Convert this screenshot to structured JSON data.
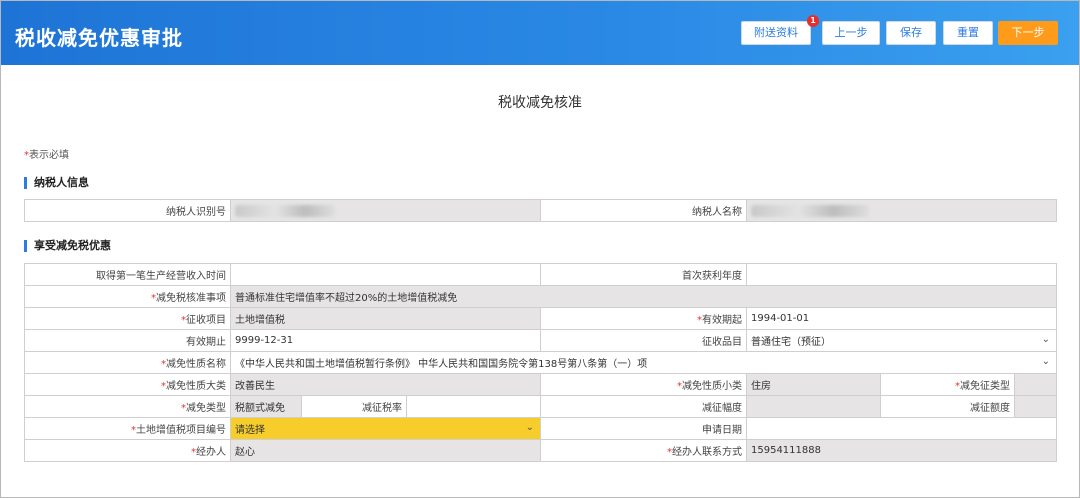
{
  "header": {
    "title": "税收减免优惠审批",
    "buttons": {
      "attach": "附送资料",
      "prev": "上一步",
      "save": "保存",
      "reset": "重置",
      "next": "下一步"
    },
    "attach_badge": "1"
  },
  "page_title": "税收减免核准",
  "required_note": "表示必填",
  "required_star": "*",
  "taxpayer": {
    "section": "纳税人信息",
    "id_label": "纳税人识别号",
    "name_label": "纳税人名称"
  },
  "benefit": {
    "section": "享受减免税优惠",
    "first_income_time_label": "取得第一笔生产经营收入时间",
    "first_income_time_value": "",
    "first_profit_year_label": "首次获利年度",
    "first_profit_year_value": "",
    "approval_item_label": "减免税核准事项",
    "approval_item_value": "普通标准住宅增值率不超过20%的土地增值税减免",
    "levy_item_label": "征收项目",
    "levy_item_value": "土地增值税",
    "valid_from_label": "有效期起",
    "valid_from_value": "1994-01-01",
    "valid_to_label": "有效期止",
    "valid_to_value": "9999-12-31",
    "levy_category_label": "征收品目",
    "levy_category_value": "普通住宅（预征）",
    "nature_name_label": "减免性质名称",
    "nature_name_value": "《中华人民共和国土地增值税暂行条例》 中华人民共和国国务院令第138号第八条第（一）项",
    "nature_major_label": "减免性质大类",
    "nature_major_value": "改善民生",
    "nature_minor_label": "减免性质小类",
    "nature_minor_value": "住房",
    "levy_reduction_type_label": "减免征类型",
    "levy_reduction_type_value": "",
    "reduction_type_label": "减免类型",
    "reduction_type_value": "税额式减免",
    "reduced_rate_label": "减征税率",
    "reduced_rate_value": "",
    "reduction_range_label": "减征幅度",
    "reduction_range_value": "",
    "reduction_amount_label": "减征额度",
    "reduction_amount_value": "",
    "project_no_label": "土地增值税项目编号",
    "project_no_value": "请选择",
    "apply_date_label": "申请日期",
    "apply_date_value": "",
    "agent_label": "经办人",
    "agent_value": "赵心",
    "agent_phone_label": "经办人联系方式",
    "agent_phone_value": "15954111888"
  },
  "colors": {
    "header_start": "#1e74d6",
    "header_end": "#3aa0ef",
    "primary_button": "#ff9b1a",
    "highlight": "#f7cd2b",
    "required": "#e53333"
  },
  "icons": [
    "chevron-down-icon"
  ]
}
